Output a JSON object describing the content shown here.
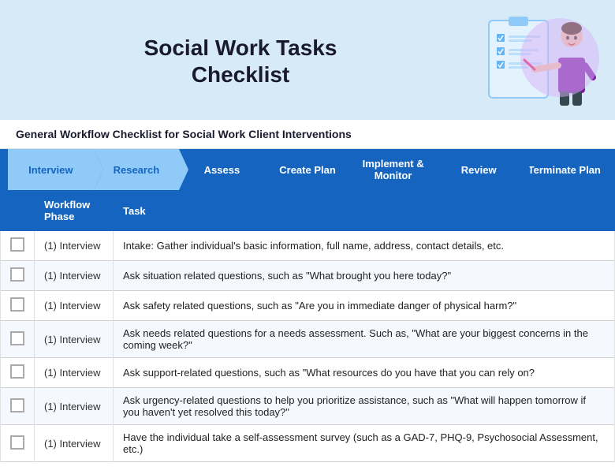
{
  "header": {
    "title_line1": "Social Work Tasks",
    "title_line2": "Checklist",
    "subtitle": "General Workflow Checklist for Social Work Client Interventions"
  },
  "tabs": [
    {
      "id": "interview",
      "label": "Interview",
      "state": "highlighted"
    },
    {
      "id": "research",
      "label": "Research",
      "state": "highlighted2"
    },
    {
      "id": "assess",
      "label": "Assess",
      "state": "normal"
    },
    {
      "id": "create-plan",
      "label": "Create Plan",
      "state": "normal"
    },
    {
      "id": "implement",
      "label": "Implement & Monitor",
      "state": "normal"
    },
    {
      "id": "review",
      "label": "Review",
      "state": "normal"
    },
    {
      "id": "terminate",
      "label": "Terminate Plan",
      "state": "normal"
    }
  ],
  "table": {
    "columns": [
      {
        "id": "check",
        "label": ""
      },
      {
        "id": "phase",
        "label": "Workflow Phase"
      },
      {
        "id": "task",
        "label": "Task"
      }
    ],
    "rows": [
      {
        "check": "",
        "phase": "(1) Interview",
        "task": "Intake: Gather individual's basic information, full name, address, contact details, etc."
      },
      {
        "check": "",
        "phase": "(1) Interview",
        "task": "Ask situation related questions, such as \"What brought you here today?\""
      },
      {
        "check": "",
        "phase": "(1) Interview",
        "task": "Ask safety related questions, such as \"Are you in immediate danger of physical harm?\""
      },
      {
        "check": "",
        "phase": "(1) Interview",
        "task": "Ask needs related questions for a needs assessment. Such as, \"What are your biggest concerns in the coming week?\""
      },
      {
        "check": "",
        "phase": "(1) Interview",
        "task": "Ask support-related questions, such as \"What resources do you have that you can rely on?"
      },
      {
        "check": "",
        "phase": "(1) Interview",
        "task": "Ask urgency-related questions to help you prioritize assistance, such as \"What will happen tomorrow if you haven't yet resolved this today?\""
      },
      {
        "check": "",
        "phase": "(1) Interview",
        "task": "Have the individual take a self-assessment survey (such as a GAD-7, PHQ-9, Psychosocial Assessment, etc.)"
      }
    ]
  }
}
